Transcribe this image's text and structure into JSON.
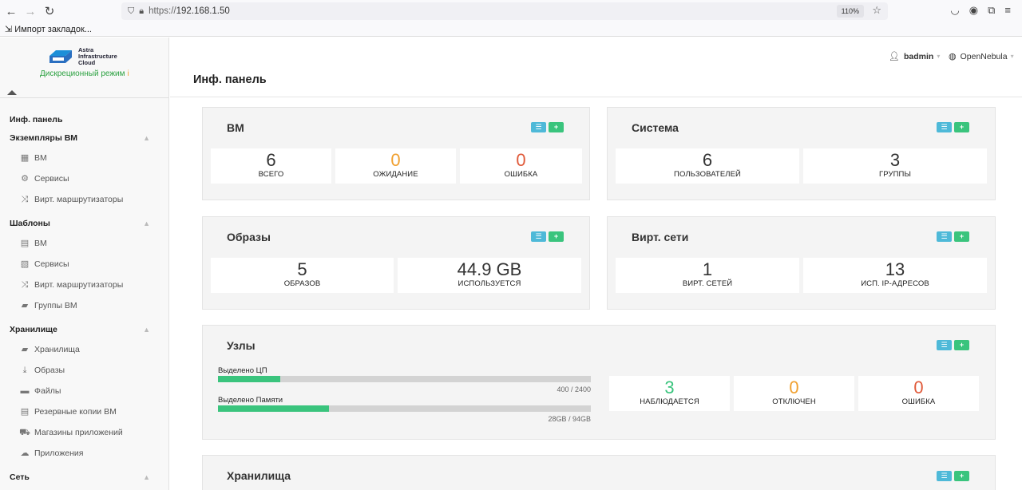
{
  "browser": {
    "url_proto": "https://",
    "url_host": "192.168.1.50",
    "zoom": "110%",
    "bookmarks_import": "Импорт закладок..."
  },
  "brand": {
    "name_line1": "Astra",
    "name_line2": "Infrastructure",
    "name_line3": "Cloud",
    "mode": "Дискреционный режим",
    "mode_info_icon": "i"
  },
  "header": {
    "user": "badmin",
    "zone": "OpenNebula",
    "page_title": "Инф. панель"
  },
  "sidebar": {
    "dashboard": "Инф. панель",
    "vm_instances": {
      "title": "Экземпляры ВМ",
      "items": [
        {
          "icon": "grid-icon",
          "glyph": "▦",
          "label": "ВМ"
        },
        {
          "icon": "cogs-icon",
          "glyph": "⚙",
          "label": "Сервисы"
        },
        {
          "icon": "shuffle-icon",
          "glyph": "⤨",
          "label": "Вирт. маршрутизаторы"
        }
      ]
    },
    "templates": {
      "title": "Шаблоны",
      "items": [
        {
          "icon": "file-icon",
          "glyph": "▤",
          "label": "ВМ"
        },
        {
          "icon": "files-icon",
          "glyph": "▧",
          "label": "Сервисы"
        },
        {
          "icon": "shuffle-icon",
          "glyph": "⤨",
          "label": "Вирт. маршрутизаторы"
        },
        {
          "icon": "folder-open-icon",
          "glyph": "▰",
          "label": "Группы ВМ"
        }
      ]
    },
    "storage": {
      "title": "Хранилище",
      "items": [
        {
          "icon": "folder-open-icon",
          "glyph": "▰",
          "label": "Хранилища"
        },
        {
          "icon": "download-icon",
          "glyph": "⤓",
          "label": "Образы"
        },
        {
          "icon": "folder-icon",
          "glyph": "▬",
          "label": "Файлы"
        },
        {
          "icon": "backup-icon",
          "glyph": "▤",
          "label": "Резервные копии ВМ"
        },
        {
          "icon": "cart-icon",
          "glyph": "⛟",
          "label": "Магазины приложений"
        },
        {
          "icon": "cloud-download-icon",
          "glyph": "☁",
          "label": "Приложения"
        }
      ]
    },
    "network": {
      "title": "Сеть"
    }
  },
  "panels": {
    "vms": {
      "title": "ВМ",
      "stats": [
        {
          "value": "6",
          "label": "ВСЕГО"
        },
        {
          "value": "0",
          "label": "ОЖИДАНИЕ"
        },
        {
          "value": "0",
          "label": "ОШИБКА"
        }
      ]
    },
    "system": {
      "title": "Система",
      "stats": [
        {
          "value": "6",
          "label": "ПОЛЬЗОВАТЕЛЕЙ"
        },
        {
          "value": "3",
          "label": "ГРУППЫ"
        }
      ]
    },
    "images": {
      "title": "Образы",
      "stats": [
        {
          "value": "5",
          "label": "ОБРАЗОВ"
        },
        {
          "value": "44.9 GB",
          "label": "ИСПОЛЬЗУЕТСЯ"
        }
      ]
    },
    "vnets": {
      "title": "Вирт. сети",
      "stats": [
        {
          "value": "1",
          "label": "ВИРТ. СЕТЕЙ"
        },
        {
          "value": "13",
          "label": "ИСП. IP-АДРЕСОВ"
        }
      ]
    },
    "hosts": {
      "title": "Узлы",
      "cpu_label": "Выделено ЦП",
      "cpu_value": "400 / 2400",
      "cpu_fraction": 0.1667,
      "mem_label": "Выделено Памяти",
      "mem_value": "28GB / 94GB",
      "mem_fraction": 0.2979,
      "stats": [
        {
          "value": "3",
          "label": "НАБЛЮДАЕТСЯ"
        },
        {
          "value": "0",
          "label": "ОТКЛЮЧЕН"
        },
        {
          "value": "0",
          "label": "ОШИБКА"
        }
      ]
    },
    "datastores": {
      "title": "Хранилища"
    }
  },
  "buttons": {
    "list": "☰",
    "add": "+"
  },
  "colors": {
    "list_button": "#4eb9d8",
    "add_button": "#3ac47d",
    "warning": "#f0a030",
    "error": "#e05a3a",
    "ok": "#3ac47d"
  }
}
